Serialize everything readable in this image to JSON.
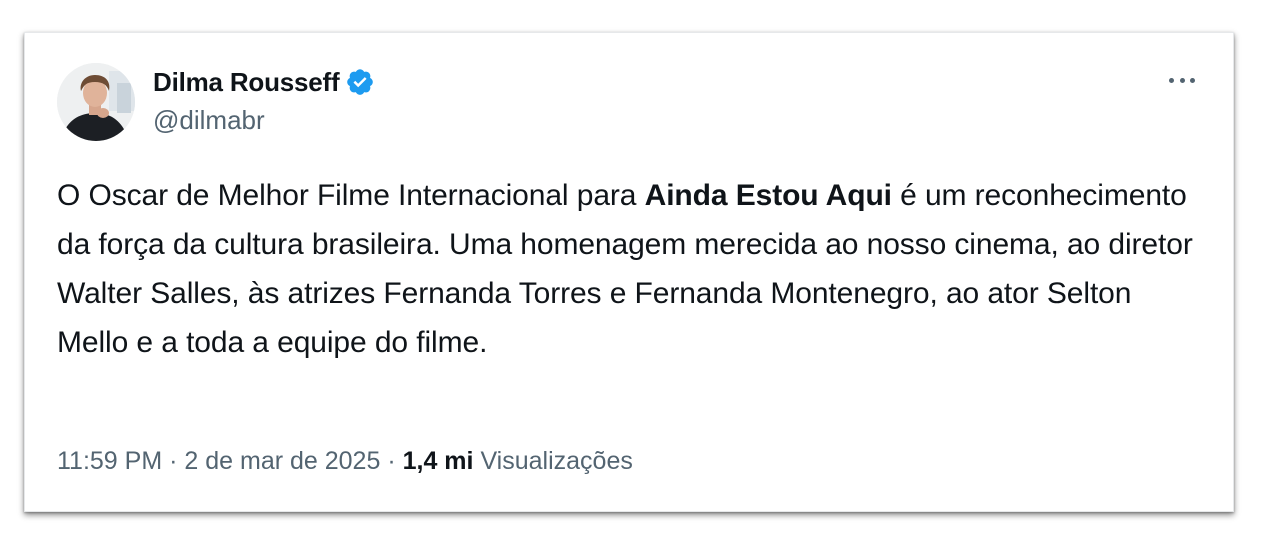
{
  "author": {
    "name": "Dilma Rousseff",
    "handle": "@dilmabr",
    "verified": true
  },
  "menu": {
    "icon": "more-horizontal-icon"
  },
  "tweet": {
    "text_before": "O Oscar de Melhor Filme Internacional para ",
    "text_bold": "Ainda Estou Aqui",
    "text_after": " é um reconhecimento da força da cultura brasileira. Uma homenagem merecida ao nosso cinema, ao diretor Walter Salles, às atrizes Fernanda Torres e Fernanda Montenegro, ao ator Selton Mello e a toda a equipe do filme."
  },
  "meta": {
    "time": "11:59 PM",
    "separator": "·",
    "date": "2 de mar de 2025",
    "views_count": "1,4 mi",
    "views_label": "Visualizações"
  },
  "colors": {
    "text_primary": "#0f1419",
    "text_secondary": "#536471",
    "verified_blue": "#1d9bf0"
  }
}
